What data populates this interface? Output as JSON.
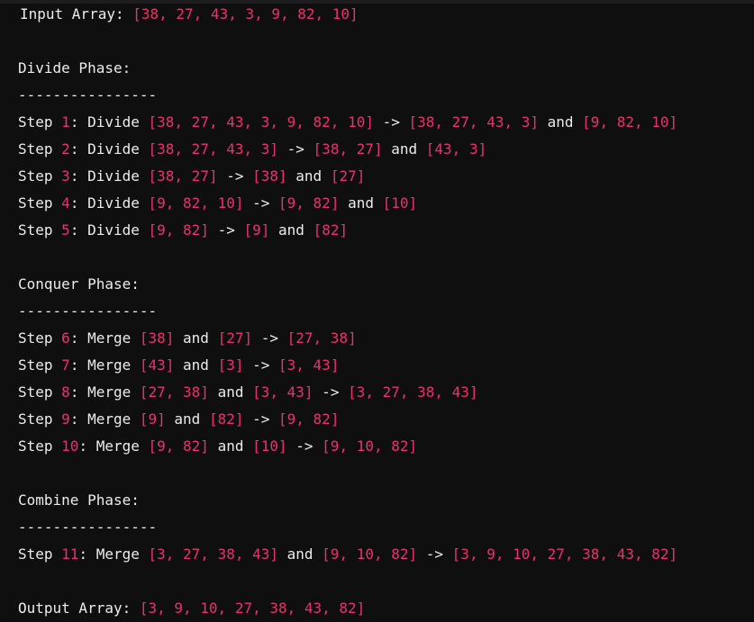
{
  "input": {
    "label": "Input Array: ",
    "value": "[38, 27, 43, 3, 9, 82, 10]"
  },
  "divide": {
    "title": "Divide Phase:",
    "rule": "----------------",
    "steps": [
      {
        "prefix": "Step ",
        "num": "1",
        "mid": ": Divide ",
        "a": "[38, 27, 43, 3, 9, 82, 10]",
        "arrow": " -> ",
        "b": "[38, 27, 43, 3]",
        "and": " and ",
        "c": "[9, 82, 10]"
      },
      {
        "prefix": "Step ",
        "num": "2",
        "mid": ": Divide ",
        "a": "[38, 27, 43, 3]",
        "arrow": " -> ",
        "b": "[38, 27]",
        "and": " and ",
        "c": "[43, 3]"
      },
      {
        "prefix": "Step ",
        "num": "3",
        "mid": ": Divide ",
        "a": "[38, 27]",
        "arrow": " -> ",
        "b": "[38]",
        "and": " and ",
        "c": "[27]"
      },
      {
        "prefix": "Step ",
        "num": "4",
        "mid": ": Divide ",
        "a": "[9, 82, 10]",
        "arrow": " -> ",
        "b": "[9, 82]",
        "and": " and ",
        "c": "[10]"
      },
      {
        "prefix": "Step ",
        "num": "5",
        "mid": ": Divide ",
        "a": "[9, 82]",
        "arrow": " -> ",
        "b": "[9]",
        "and": " and ",
        "c": "[82]"
      }
    ]
  },
  "conquer": {
    "title": "Conquer Phase:",
    "rule": "----------------",
    "steps": [
      {
        "prefix": "Step ",
        "num": "6",
        "mid": ": Merge ",
        "a": "[38]",
        "and": " and ",
        "b": "[27]",
        "arrow": " -> ",
        "c": "[27, 38]"
      },
      {
        "prefix": "Step ",
        "num": "7",
        "mid": ": Merge ",
        "a": "[43]",
        "and": " and ",
        "b": "[3]",
        "arrow": " -> ",
        "c": "[3, 43]"
      },
      {
        "prefix": "Step ",
        "num": "8",
        "mid": ": Merge ",
        "a": "[27, 38]",
        "and": " and ",
        "b": "[3, 43]",
        "arrow": " -> ",
        "c": "[3, 27, 38, 43]"
      },
      {
        "prefix": "Step ",
        "num": "9",
        "mid": ": Merge ",
        "a": "[9]",
        "and": " and ",
        "b": "[82]",
        "arrow": " -> ",
        "c": "[9, 82]"
      },
      {
        "prefix": "Step ",
        "num": "10",
        "mid": ": Merge ",
        "a": "[9, 82]",
        "and": " and ",
        "b": "[10]",
        "arrow": " -> ",
        "c": "[9, 10, 82]"
      }
    ]
  },
  "combine": {
    "title": "Combine Phase:",
    "rule": "----------------",
    "steps": [
      {
        "prefix": "Step ",
        "num": "11",
        "mid": ": Merge ",
        "a": "[3, 27, 38, 43]",
        "and": " and ",
        "b": "[9, 10, 82]",
        "arrow": " -> ",
        "c": "[3, 9, 10, 27, 38, 43, 82]"
      }
    ]
  },
  "output": {
    "label": "Output Array: ",
    "value": "[3, 9, 10, 27, 38, 43, 82]"
  },
  "colors": {
    "background": "#0f0f10",
    "text": "#ececec",
    "highlight": "#e8346b"
  }
}
